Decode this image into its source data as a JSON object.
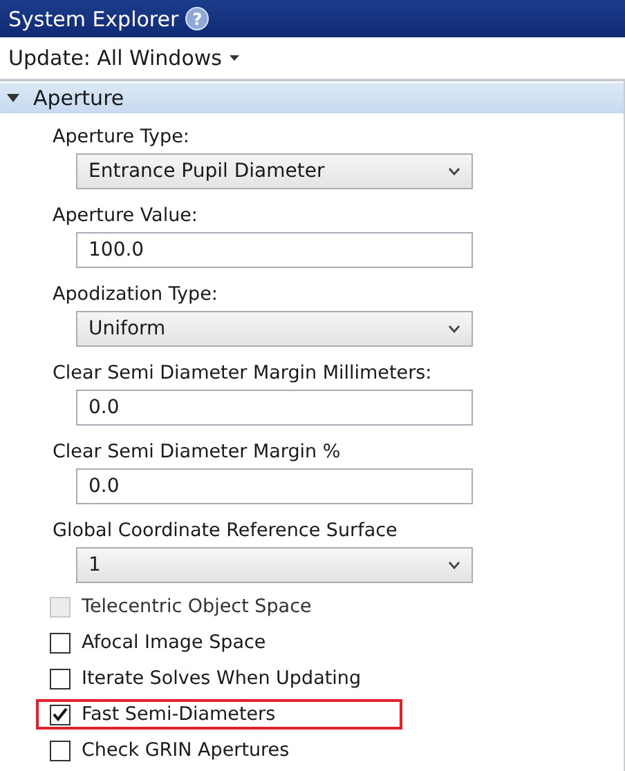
{
  "window": {
    "title": "System Explorer",
    "help_icon": "?"
  },
  "update_menu": {
    "label": "Update: All Windows"
  },
  "section": {
    "title": "Aperture",
    "expanded": true
  },
  "fields": [
    {
      "label": "Aperture Type:",
      "kind": "dropdown",
      "value": "Entrance Pupil Diameter"
    },
    {
      "label": "Aperture Value:",
      "kind": "text",
      "value": "100.0"
    },
    {
      "label": "Apodization Type:",
      "kind": "dropdown",
      "value": "Uniform"
    },
    {
      "label": "Clear Semi Diameter Margin Millimeters:",
      "kind": "text",
      "value": "0.0"
    },
    {
      "label": "Clear Semi Diameter Margin %",
      "kind": "text",
      "value": "0.0"
    },
    {
      "label": "Global Coordinate Reference Surface",
      "kind": "dropdown",
      "value": "1"
    }
  ],
  "checkboxes": [
    {
      "label": "Telecentric Object Space",
      "checked": false,
      "disabled": true,
      "highlighted": false
    },
    {
      "label": "Afocal Image Space",
      "checked": false,
      "disabled": false,
      "highlighted": false
    },
    {
      "label": "Iterate Solves When Updating",
      "checked": false,
      "disabled": false,
      "highlighted": false
    },
    {
      "label": "Fast Semi-Diameters",
      "checked": true,
      "disabled": false,
      "highlighted": true
    },
    {
      "label": "Check GRIN Apertures",
      "checked": false,
      "disabled": false,
      "highlighted": false
    }
  ]
}
